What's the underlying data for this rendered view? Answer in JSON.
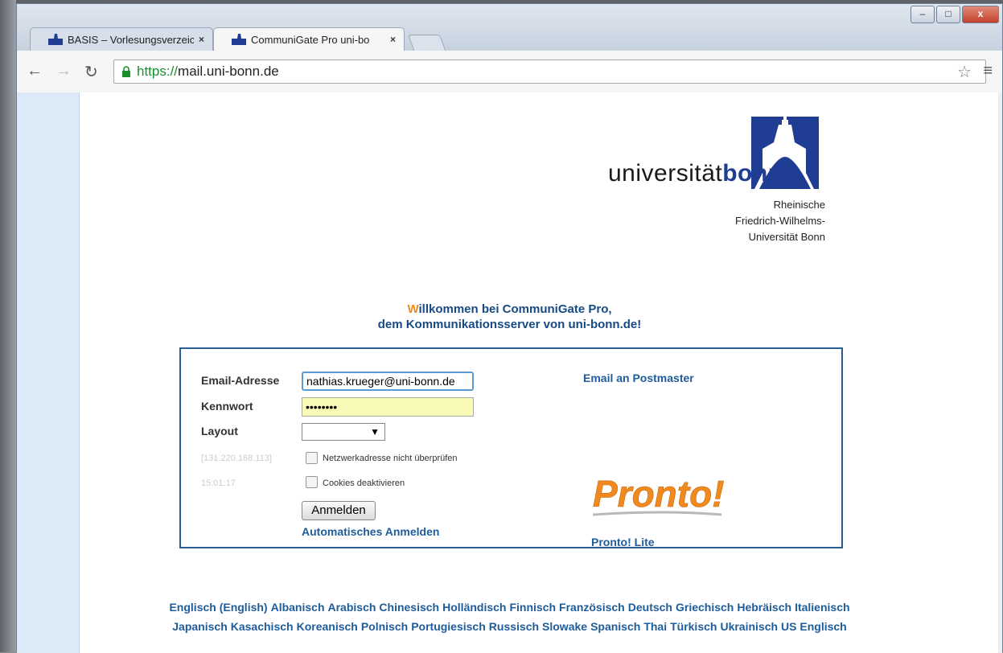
{
  "browser": {
    "tabs": [
      {
        "label": "BASIS – Vorlesungsverzeic",
        "close": "×"
      },
      {
        "label": "CommuniGate Pro uni-bo",
        "close": "×"
      }
    ],
    "url_scheme": "https://",
    "url_host": "mail.uni-bonn.de",
    "window_buttons": {
      "minimize": "–",
      "maximize": "□",
      "close": "x"
    }
  },
  "logo": {
    "word_light": "universität",
    "word_bold": "bonn",
    "subtitle_lines": [
      "Rheinische",
      "Friedrich-Wilhelms-",
      "Universität Bonn"
    ]
  },
  "welcome": {
    "first_letter": "W",
    "line1_rest": "illkommen bei CommuniGate Pro,",
    "line2": "dem Kommunikationsserver von uni-bonn.de!"
  },
  "login": {
    "email_label": "Email-Adresse",
    "email_value": "nathias.krueger@uni-bonn.de",
    "password_label": "Kennwort",
    "password_value": "••••••••",
    "layout_label": "Layout",
    "layout_value": "",
    "ip_address": "[131.220.168.113]",
    "time": "15:01:17",
    "checkbox_network": "Netzwerkadresse nicht überprüfen",
    "checkbox_cookies": "Cookies deaktivieren",
    "submit_label": "Anmelden",
    "auto_login_link": "Automatisches Anmelden",
    "postmaster_link": "Email an Postmaster",
    "pronto_logo_text": "Pronto!",
    "pronto_lite_link": "Pronto! Lite"
  },
  "languages": {
    "line1": [
      "Englisch (English)",
      "Albanisch",
      "Arabisch",
      "Chinesisch",
      "Holländisch",
      "Finnisch",
      "Französisch",
      "Deutsch",
      "Griechisch",
      "Hebräisch",
      "Italienisch"
    ],
    "line2": [
      "Japanisch",
      "Kasachisch",
      "Koreanisch",
      "Polnisch",
      "Portugiesisch",
      "Russisch",
      "Slowake",
      "Spanisch",
      "Thai",
      "Türkisch",
      "Ukrainisch",
      "US Englisch"
    ]
  },
  "colors": {
    "accent": "#1f5c9a",
    "orange": "#f08a1e",
    "uni_blue": "#1e3d93"
  }
}
